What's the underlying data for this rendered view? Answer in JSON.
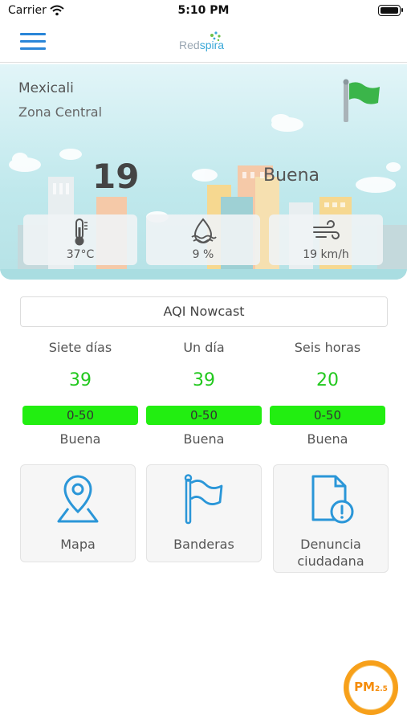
{
  "status_bar": {
    "carrier": "Carrier",
    "time": "5:10 PM"
  },
  "header": {
    "logo_part1": "Red",
    "logo_part2": "spira",
    "accent_color": "#2a86d8"
  },
  "hero": {
    "city": "Mexicali",
    "zone": "Zona Central",
    "aqi_value": "19",
    "aqi_label": "Buena",
    "metrics": [
      {
        "icon": "thermometer-icon",
        "value": "37°C"
      },
      {
        "icon": "humidity-icon",
        "value": "9 %"
      },
      {
        "icon": "wind-icon",
        "value": "19 km/h"
      }
    ]
  },
  "nowcast": {
    "title": "AQI Nowcast",
    "columns": [
      {
        "title": "Siete días",
        "value": "39",
        "range": "0-50",
        "label": "Buena"
      },
      {
        "title": "Un día",
        "value": "39",
        "range": "0-50",
        "label": "Buena"
      },
      {
        "title": "Seis horas",
        "value": "20",
        "range": "0-50",
        "label": "Buena"
      }
    ],
    "good_color": "#22ee11"
  },
  "tiles": [
    {
      "icon": "map-pin-icon",
      "label": "Mapa"
    },
    {
      "icon": "flag-icon",
      "label": "Banderas"
    },
    {
      "icon": "document-alert-icon",
      "label": "Denuncia ciudadana"
    }
  ],
  "pm_button": {
    "label_main": "PM",
    "label_sub": "2.5"
  }
}
